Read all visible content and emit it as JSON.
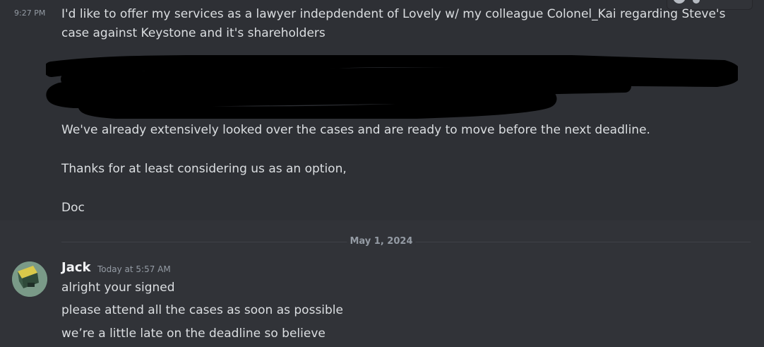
{
  "colors": {
    "background": "#313338",
    "hover_background": "#2e3035",
    "text": "#dbdee1",
    "muted": "#949ba4",
    "author": "#f2f3f5",
    "redaction": "#000000"
  },
  "previous_message": {
    "timestamp": "9:27 PM",
    "paragraphs": [
      "I'd like to offer my services as a lawyer indepdendent of Lovely w/ my colleague Colonel_Kai regarding Steve's",
      "case against Keystone and it's shareholders",
      "We've already extensively looked over the cases and are ready to move before the next deadline.",
      "Thanks for at least considering us as an option,",
      "Doc"
    ],
    "redaction_icon": "scribble-redaction"
  },
  "date_divider": {
    "label": "May 1, 2024"
  },
  "message": {
    "author": "Jack",
    "timestamp": "Today at 5:57 AM",
    "avatar_icon": "avatar-image",
    "lines": [
      "alright your signed",
      "please attend all the cases as soon as possible",
      "we’re a little late on the deadline so believe"
    ]
  }
}
